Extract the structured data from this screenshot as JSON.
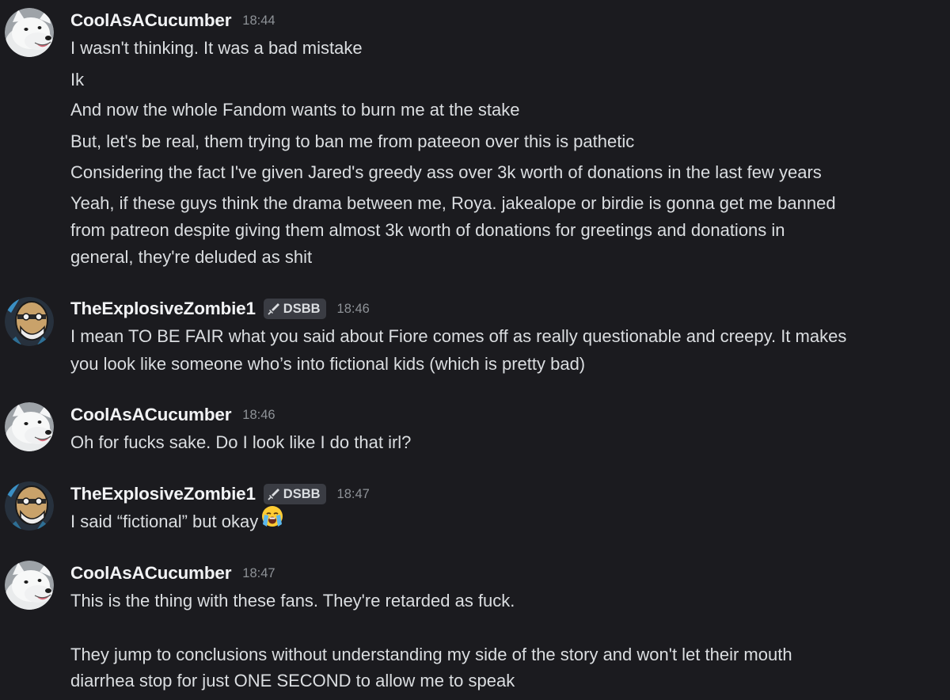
{
  "messages": [
    {
      "author": "CoolAsACucumber",
      "avatar": "arctic-fox-avatar",
      "time": "18:44",
      "lines": [
        "I wasn't thinking. It was a bad mistake",
        "Ik",
        "And now the whole Fandom wants to burn me at the stake",
        "But, let's be real, them trying to ban me from pateeon over this is pathetic",
        "Considering the fact I've given Jared's greedy ass over 3k worth of donations in the last few years",
        "Yeah, if these guys think the drama between me, Roya. jakealope or birdie is gonna get me banned",
        "from patreon despite giving them almost 3k worth of donations for greetings and donations in",
        "general, they're deluded as shit"
      ]
    },
    {
      "author": "TheExplosiveZombie1",
      "avatar": "cartoon-old-man-avatar",
      "tag": "DSBB",
      "tag_icon": "sword-icon",
      "time": "18:46",
      "lines": [
        "I mean TO BE FAIR what you said about Fiore comes off as really questionable and creepy. It makes",
        "you look like someone who’s into fictional kids (which is pretty bad)"
      ]
    },
    {
      "author": "CoolAsACucumber",
      "avatar": "arctic-fox-avatar",
      "time": "18:46",
      "lines": [
        "Oh for fucks sake. Do I look like I do that irl?"
      ]
    },
    {
      "author": "TheExplosiveZombie1",
      "avatar": "cartoon-old-man-avatar",
      "tag": "DSBB",
      "tag_icon": "sword-icon",
      "time": "18:47",
      "lines": [
        "I said “fictional” but okay"
      ],
      "emoji": "loudly-crying-face-emoji"
    },
    {
      "author": "CoolAsACucumber",
      "avatar": "arctic-fox-avatar",
      "time": "18:47",
      "lines": [
        "This is the thing with these fans. They're retarded as fuck.",
        "They jump to conclusions without understanding my side of the story and won't let their mouth",
        "diarrhea stop for just ONE SECOND to allow me to speak"
      ]
    }
  ],
  "colors": {
    "background": "#1b1b1f",
    "username": "#f2f3f5",
    "text": "#dbdee1",
    "timestamp": "#8e9297",
    "tag_background": "#3a3c43"
  }
}
